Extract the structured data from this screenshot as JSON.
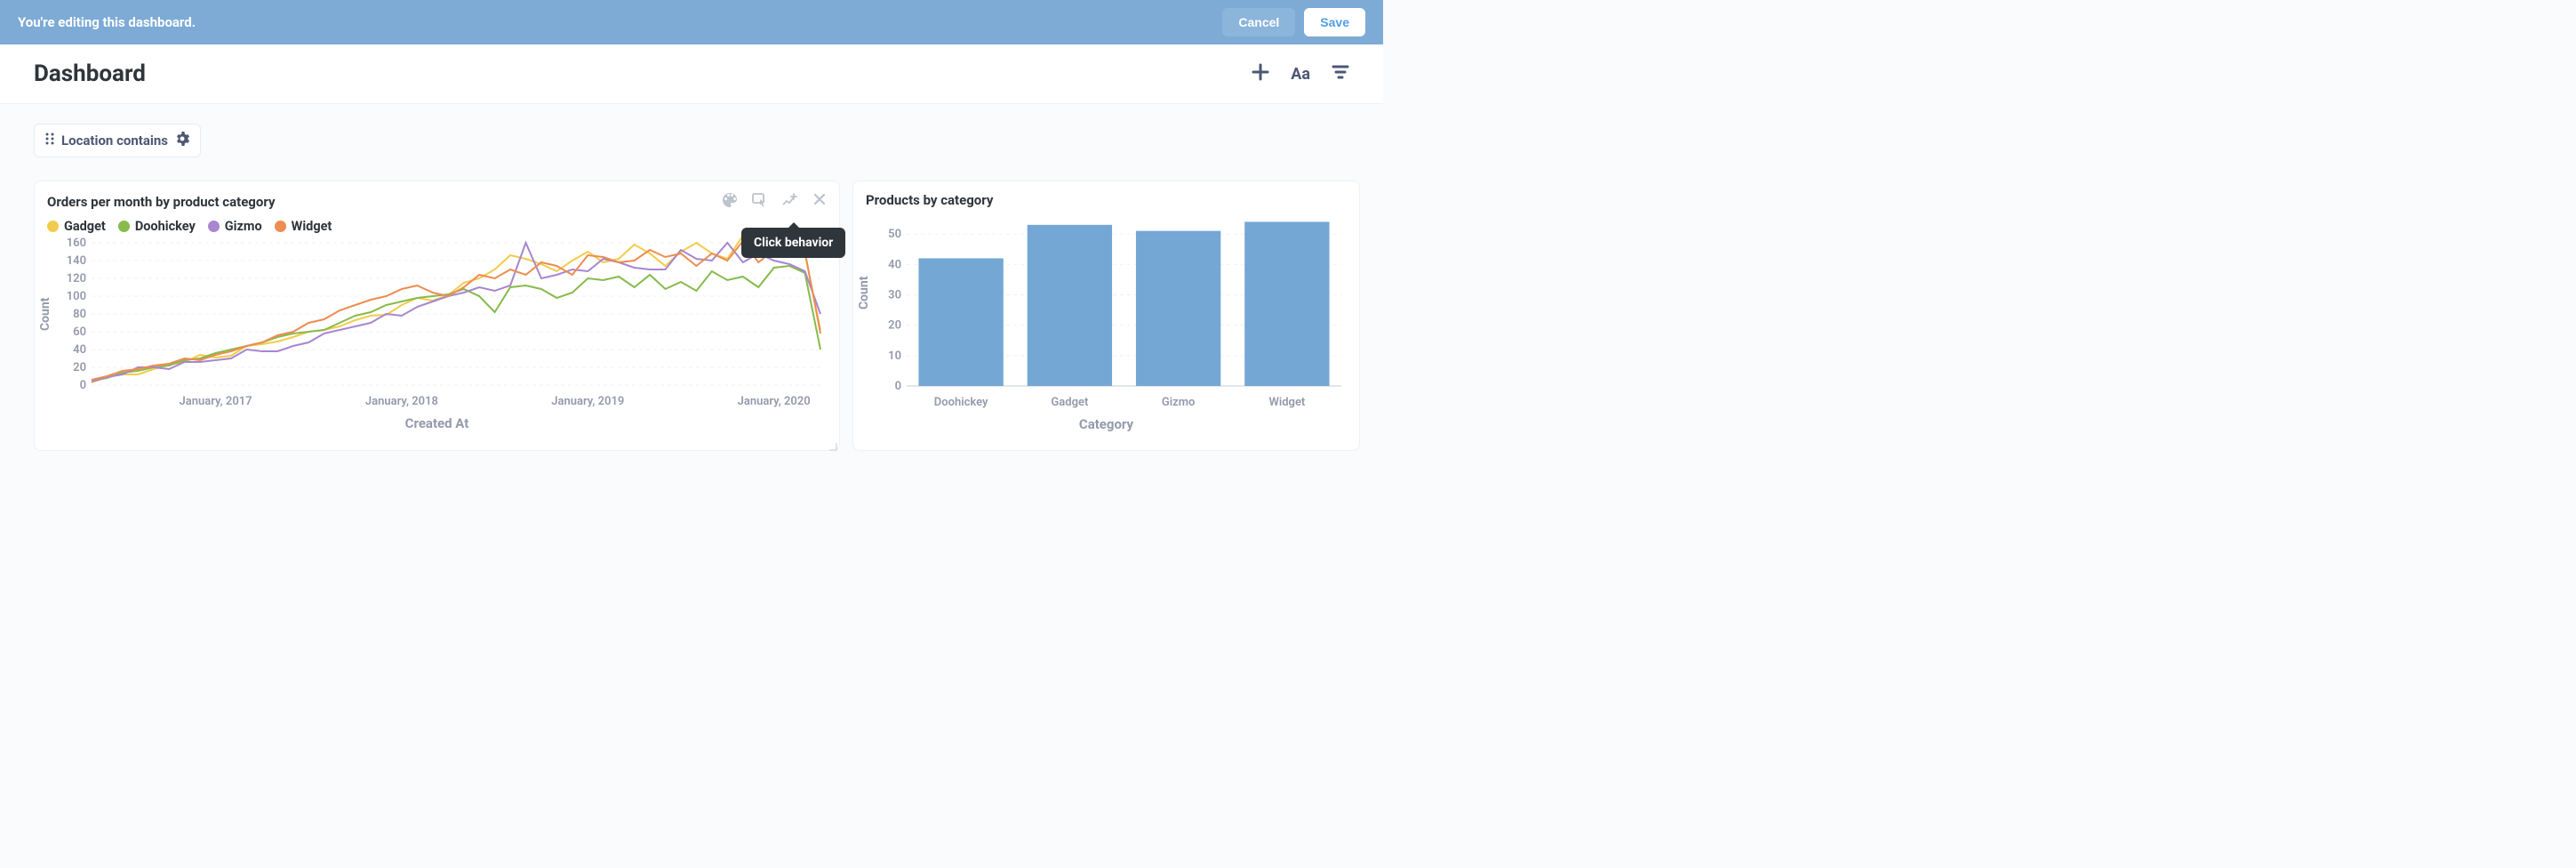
{
  "banner": {
    "message": "You're editing this dashboard.",
    "cancel_label": "Cancel",
    "save_label": "Save"
  },
  "title": "Dashboard",
  "filter": {
    "label": "Location contains"
  },
  "tooltip": {
    "click_behavior": "Click behavior"
  },
  "chart_data": [
    {
      "type": "line",
      "title": "Orders per month by product category",
      "xlabel": "Created At",
      "ylabel": "Count",
      "ylim": [
        0,
        160
      ],
      "x_ticks": [
        "January, 2017",
        "January, 2018",
        "January, 2019",
        "January, 2020"
      ],
      "x": [
        "2016-05",
        "2016-06",
        "2016-07",
        "2016-08",
        "2016-09",
        "2016-10",
        "2016-11",
        "2016-12",
        "2017-01",
        "2017-02",
        "2017-03",
        "2017-04",
        "2017-05",
        "2017-06",
        "2017-07",
        "2017-08",
        "2017-09",
        "2017-10",
        "2017-11",
        "2017-12",
        "2018-01",
        "2018-02",
        "2018-03",
        "2018-04",
        "2018-05",
        "2018-06",
        "2018-07",
        "2018-08",
        "2018-09",
        "2018-10",
        "2018-11",
        "2018-12",
        "2019-01",
        "2019-02",
        "2019-03",
        "2019-04",
        "2019-05",
        "2019-06",
        "2019-07",
        "2019-08",
        "2019-09",
        "2019-10",
        "2019-11",
        "2019-12",
        "2020-01",
        "2020-02",
        "2020-03",
        "2020-04"
      ],
      "series": [
        {
          "name": "Gadget",
          "color": "#f2cc4b",
          "values": [
            3,
            9,
            12,
            12,
            18,
            23,
            26,
            34,
            31,
            33,
            44,
            46,
            49,
            54,
            60,
            62,
            66,
            73,
            78,
            79,
            90,
            98,
            95,
            101,
            115,
            120,
            130,
            146,
            142,
            136,
            128,
            140,
            150,
            138,
            142,
            158,
            148,
            134,
            150,
            160,
            148,
            142,
            168,
            146,
            154,
            155,
            148,
            62
          ]
        },
        {
          "name": "Doohickey",
          "color": "#87bb4b",
          "values": [
            5,
            8,
            14,
            16,
            20,
            22,
            28,
            30,
            36,
            40,
            44,
            48,
            54,
            58,
            60,
            62,
            70,
            78,
            82,
            90,
            94,
            98,
            100,
            102,
            108,
            100,
            82,
            110,
            112,
            108,
            98,
            104,
            120,
            118,
            122,
            110,
            124,
            108,
            116,
            106,
            128,
            118,
            122,
            110,
            132,
            134,
            126,
            40
          ]
        },
        {
          "name": "Gizmo",
          "color": "#a886d0",
          "values": [
            4,
            9,
            12,
            20,
            20,
            18,
            26,
            26,
            28,
            30,
            40,
            38,
            38,
            44,
            48,
            58,
            62,
            66,
            70,
            80,
            78,
            88,
            94,
            100,
            104,
            110,
            106,
            112,
            160,
            120,
            124,
            130,
            128,
            142,
            138,
            132,
            130,
            130,
            152,
            142,
            140,
            160,
            138,
            148,
            140,
            136,
            128,
            80
          ]
        },
        {
          "name": "Widget",
          "color": "#ec8d51",
          "values": [
            6,
            10,
            16,
            18,
            22,
            24,
            30,
            28,
            34,
            38,
            44,
            48,
            56,
            60,
            70,
            74,
            84,
            90,
            96,
            100,
            108,
            112,
            104,
            100,
            110,
            124,
            120,
            130,
            124,
            138,
            134,
            124,
            146,
            144,
            138,
            140,
            152,
            144,
            148,
            134,
            148,
            140,
            162,
            138,
            152,
            148,
            150,
            58
          ]
        }
      ]
    },
    {
      "type": "bar",
      "title": "Products by category",
      "xlabel": "Category",
      "ylabel": "Count",
      "ylim": [
        0,
        55
      ],
      "categories": [
        "Doohickey",
        "Gadget",
        "Gizmo",
        "Widget"
      ],
      "values": [
        42,
        53,
        51,
        54
      ],
      "bar_color": "#74a7d4"
    }
  ]
}
